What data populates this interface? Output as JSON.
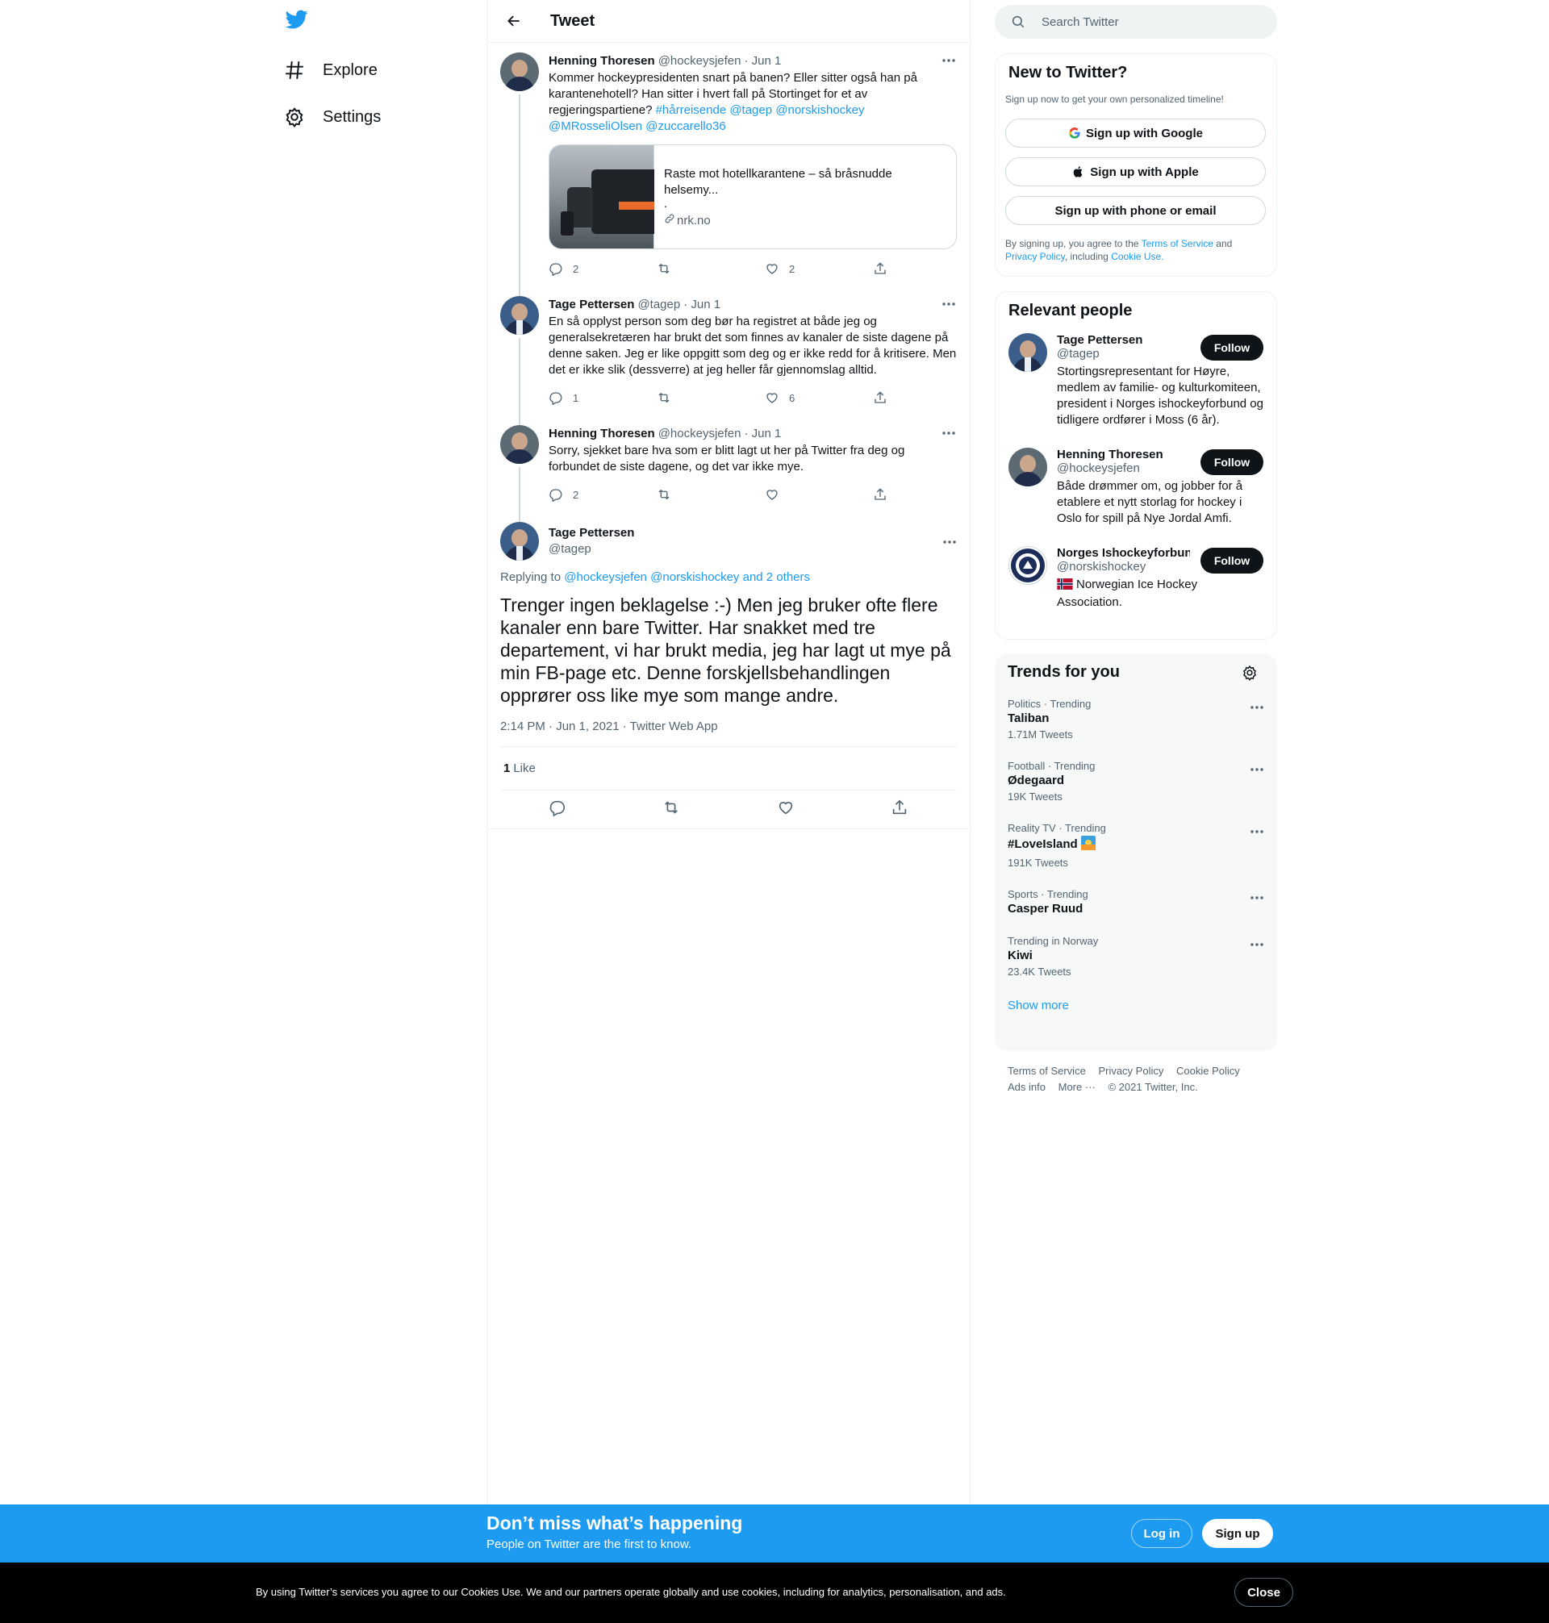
{
  "nav": {
    "explore": "Explore",
    "settings": "Settings"
  },
  "header": {
    "title": "Tweet"
  },
  "thread": [
    {
      "name": "Henning Thoresen",
      "handle": "@hockeysjefen",
      "date": "· Jun 1",
      "text_plain": "Kommer hockeypresidenten snart på banen? Eller sitter også han på karantenehotell? Han sitter i hvert fall på Stortinget for et av regjeringspartiene?",
      "text_links": "#hårreisende @tagep @norskishockey @MRosseliOlsen @zuccarello36",
      "card": {
        "title": "Raste mot hotellkarantene – så bråsnudde helsemy...",
        "desc": ".",
        "domain": "nrk.no"
      },
      "replies": "2",
      "retweets": "",
      "likes": "2"
    },
    {
      "name": "Tage Pettersen",
      "handle": "@tagep",
      "date": "· Jun 1",
      "text_plain": "En så opplyst person som deg bør ha registret at både jeg og generalsekretæren har brukt det som finnes av kanaler de siste dagene på denne saken. Jeg er like oppgitt som deg og er ikke redd for å kritisere. Men det er ikke slik (dessverre) at jeg heller får gjennomslag alltid.",
      "replies": "1",
      "retweets": "",
      "likes": "6"
    },
    {
      "name": "Henning Thoresen",
      "handle": "@hockeysjefen",
      "date": "· Jun 1",
      "text_plain": "Sorry, sjekket bare hva som er blitt lagt ut her på Twitter fra deg og forbundet de siste dagene, og det var ikke mye.",
      "replies": "2",
      "retweets": "",
      "likes": ""
    }
  ],
  "focus": {
    "name": "Tage Pettersen",
    "handle": "@tagep",
    "replying_prefix": "Replying to",
    "replying_links": "@hockeysjefen @norskishockey and 2 others",
    "text": "Trenger ingen beklagelse :-) Men jeg bruker ofte flere kanaler enn bare Twitter. Har snakket med tre departement, vi har brukt media, jeg har lagt ut mye på min FB-page etc. Denne forskjellsbehandlingen opprører oss like mye som mange andre.",
    "timestamp": "2:14 PM · Jun 1, 2021 · Twitter Web App",
    "like_count": "1",
    "like_label": "Like"
  },
  "search": {
    "placeholder": "Search Twitter"
  },
  "new_to_twitter": {
    "title": "New to Twitter?",
    "subtitle": "Sign up now to get your own personalized timeline!",
    "google": "Sign up with Google",
    "apple": "Sign up with Apple",
    "phone": "Sign up with phone or email",
    "legal_1": "By signing up, you agree to the",
    "terms": "Terms of Service",
    "legal_2": "and",
    "privacy": "Privacy Policy",
    "legal_3": ", including",
    "cookie": "Cookie Use."
  },
  "relevant": {
    "title": "Relevant people",
    "follow_label": "Follow",
    "people": [
      {
        "name": "Tage Pettersen",
        "handle": "@tagep",
        "bio": "Stortingsrepresentant for Høyre, medlem av familie- og kulturkomiteen, president i Norges ishockeyforbund og tidligere ordfører i Moss (6 år)."
      },
      {
        "name": "Henning Thoresen",
        "handle": "@hockeysjefen",
        "bio": "Både drømmer om, og jobber for å etablere et nytt storlag for hockey i Oslo for spill på Nye Jordal Amfi."
      },
      {
        "name": "Norges Ishockeyforbund",
        "handle": "@norskishockey",
        "bio": "Norwegian Ice Hockey Association."
      }
    ]
  },
  "trends": {
    "title": "Trends for you",
    "items": [
      {
        "context": "Politics · Trending",
        "name": "Taliban",
        "count": "1.71M Tweets"
      },
      {
        "context": "Football · Trending",
        "name": "Ødegaard",
        "count": "19K Tweets"
      },
      {
        "context": "Reality TV · Trending",
        "name": "#LoveIsland",
        "count": "191K Tweets"
      },
      {
        "context": "Sports · Trending",
        "name": "Casper Ruud",
        "count": ""
      },
      {
        "context": "Trending in Norway",
        "name": "Kiwi",
        "count": "23.4K Tweets"
      }
    ],
    "show_more": "Show more"
  },
  "footer": {
    "terms": "Terms of Service",
    "privacy": "Privacy Policy",
    "cookie": "Cookie Policy",
    "ads": "Ads info",
    "more": "More ···",
    "copyright": "© 2021 Twitter, Inc."
  },
  "signup_bar": {
    "title": "Don’t miss what’s happening",
    "subtitle": "People on Twitter are the first to know.",
    "login": "Log in",
    "signup": "Sign up"
  },
  "cookie_bar": {
    "text": "By using Twitter’s services you agree to our Cookies Use. We and our partners operate globally and use cookies, including for analytics, personalisation, and ads.",
    "close": "Close"
  },
  "colors": {
    "accent": "#1d9bf0",
    "text": "#0f1419",
    "muted": "#536471"
  }
}
